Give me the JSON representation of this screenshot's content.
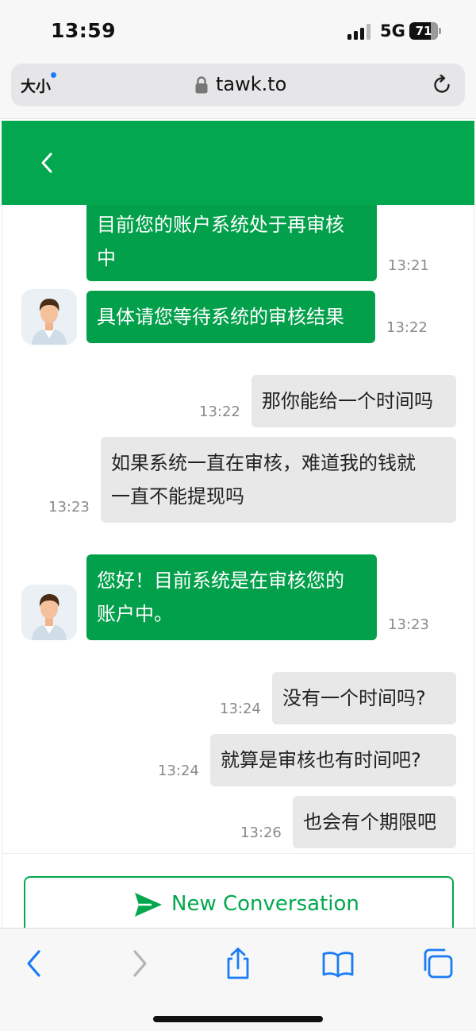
{
  "status_bar": {
    "time": "13:59",
    "network": "5G",
    "battery_level": "71"
  },
  "browser": {
    "text_size_label": "大小",
    "domain": "tawk.to"
  },
  "chat": {
    "messages": [
      {
        "sender": "agent",
        "text_lines": [
          "目前您的账户系统处于再审核",
          "中"
        ],
        "time": "13:21"
      },
      {
        "sender": "agent",
        "text_lines": [
          "具体请您等待系统的审核结果"
        ],
        "time": "13:22"
      },
      {
        "sender": "user",
        "text_lines": [
          "那你能给一个时间吗"
        ],
        "time": "13:22"
      },
      {
        "sender": "user",
        "text_lines": [
          "如果系统一直在审核，难道我的钱就",
          "一直不能提现吗"
        ],
        "time": "13:23"
      },
      {
        "sender": "agent",
        "text_lines": [
          "您好！目前系统是在审核您的",
          "账户中。"
        ],
        "time": "13:23"
      },
      {
        "sender": "user",
        "text_lines": [
          "没有一个时间吗?"
        ],
        "time": "13:24"
      },
      {
        "sender": "user",
        "text_lines": [
          "就算是审核也有时间吧?"
        ],
        "time": "13:24"
      },
      {
        "sender": "user",
        "text_lines": [
          "也会有个期限吧"
        ],
        "time": "13:26"
      }
    ]
  },
  "footer": {
    "new_conversation_label": "New Conversation"
  },
  "colors": {
    "brand_green": "#03a84e",
    "agent_bubble": "#03a04b",
    "user_bubble": "#e8e8e8",
    "ios_blue": "#1a7cf5"
  },
  "icons": {
    "header": "chevron-left-icon",
    "footer": "send-icon",
    "toolbar": [
      "back-icon",
      "forward-icon",
      "share-icon",
      "bookmarks-icon",
      "tabs-icon"
    ]
  }
}
